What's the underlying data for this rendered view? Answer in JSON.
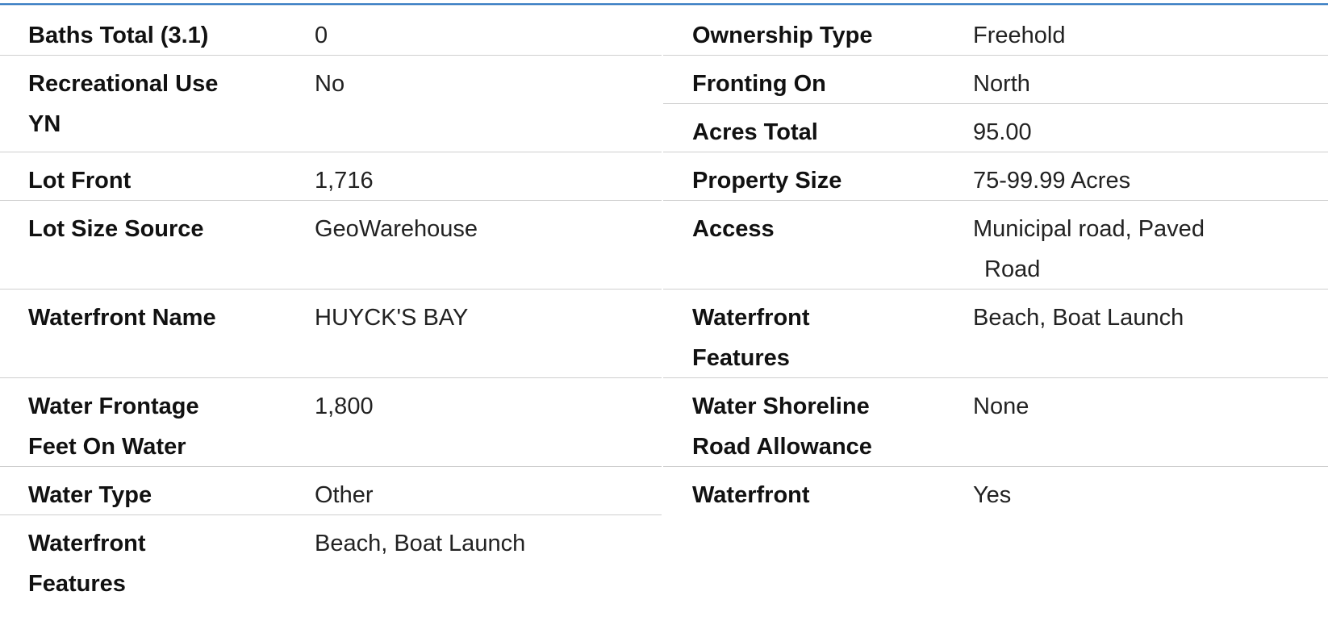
{
  "left": [
    {
      "label": "Baths Total (3.1)",
      "value": "0"
    },
    {
      "label": "Recreational Use YN",
      "value": "No"
    },
    {
      "label": "Lot Front",
      "value": "1,716"
    },
    {
      "label": "Lot Size Source",
      "value": "GeoWarehouse"
    },
    {
      "label": "Waterfront Name",
      "value": "HUYCK'S BAY"
    },
    {
      "label": "Water Frontage Feet On Water",
      "value": "1,800"
    },
    {
      "label": "Water Type",
      "value": "Other"
    },
    {
      "label": "Waterfront Features",
      "value": "Beach, Boat Launch"
    }
  ],
  "right": [
    {
      "label": "Ownership Type",
      "value": "Freehold"
    },
    {
      "label": "Fronting On",
      "value": "North"
    },
    {
      "label": "Acres Total",
      "value": "95.00"
    },
    {
      "label": "Property Size",
      "value": "75-99.99 Acres"
    },
    {
      "label": "Access",
      "value": "Municipal road, Paved Road"
    },
    {
      "label": "Waterfront Features",
      "value": "Beach, Boat Launch"
    },
    {
      "label": "Water Shoreline Road Allowance",
      "value": "None"
    },
    {
      "label": "Waterfront",
      "value": "Yes"
    }
  ]
}
